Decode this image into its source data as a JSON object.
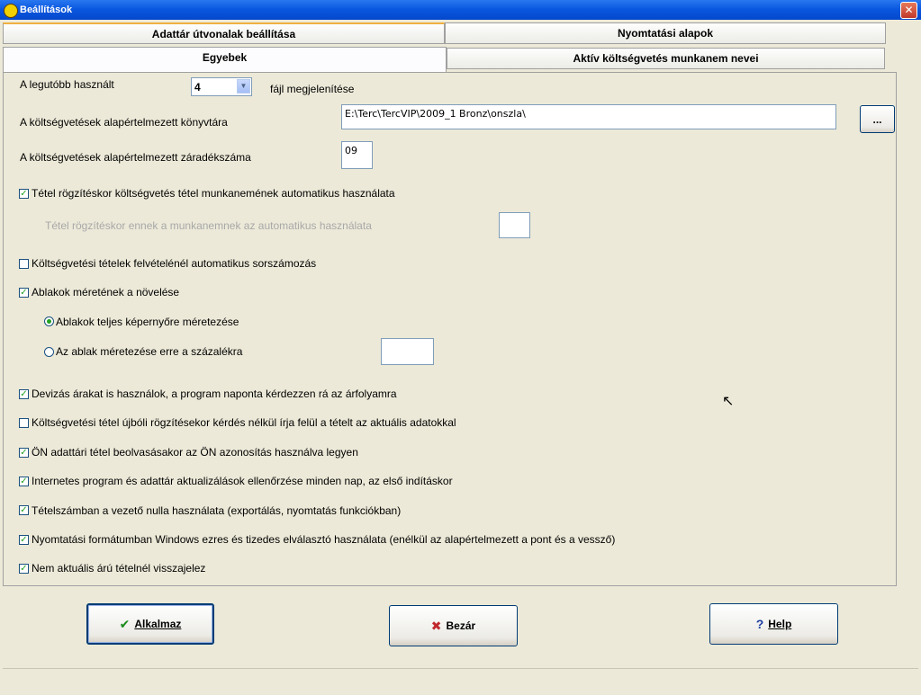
{
  "window": {
    "title": "Beállítások",
    "close_glyph": "✕"
  },
  "tabs": {
    "row1": [
      "Adattár útvonalak beállítása",
      "Nyomtatási alapok"
    ],
    "row2": [
      "Egyebek",
      "Aktív költségvetés munkanem nevei"
    ]
  },
  "recent": {
    "label": "A legutóbb használt",
    "value": "4",
    "suffix": "fájl megjelenítése"
  },
  "folder": {
    "label": "A költségvetések alapértelmezett könyvtára",
    "value": "E:\\Terc\\TercVIP\\2009_1 Bronz\\onszla\\",
    "browse_label": "..."
  },
  "clause": {
    "label": "A költségvetések alapértelmezett záradékszáma",
    "value": "09"
  },
  "options": {
    "auto_workgroup": {
      "label": "Tétel rögzítéskor költségvetés tétel munkanemének automatikus használata",
      "checked": true
    },
    "auto_workgroup_sub": {
      "label": "Tétel rögzítéskor ennek a munkanemnek az automatikus használata",
      "value": ""
    },
    "auto_numbering": {
      "label": "Költségvetési tételek felvételénél automatikus sorszámozás",
      "checked": false
    },
    "enlarge_windows": {
      "label": "Ablakok méretének a növelése",
      "checked": true
    },
    "fullscreen": {
      "label": "Ablakok teljes képernyőre méretezése",
      "selected": true
    },
    "percent": {
      "label": "Az ablak méretezése erre a százalékra",
      "selected": false,
      "value": ""
    },
    "currency": {
      "label": "Devizás árakat is használok, a program naponta kérdezzen rá az árfolyamra",
      "checked": true
    },
    "overwrite": {
      "label": "Költségvetési tétel újbóli rögzítésekor kérdés nélkül írja felül a tételt az aktuális adatokkal",
      "checked": false
    },
    "on_id": {
      "label": "ÖN adattári tétel beolvasásakor az ÖN azonosítás használva legyen",
      "checked": true
    },
    "internet_update": {
      "label": "Internetes program és adattár aktualizálások ellenőrzése minden nap, az első indításkor",
      "checked": true
    },
    "leading_zero": {
      "label": "Tételszámban a vezető nulla használata (exportálás, nyomtatás funkciókban)",
      "checked": true
    },
    "windows_separators": {
      "label": "Nyomtatási formátumban Windows ezres és tizedes elválasztó használata (enélkül az alapértelmezett a pont és a vessző)",
      "checked": true
    },
    "not_current_price": {
      "label": "Nem aktuális árú tételnél visszajelez",
      "checked": true
    }
  },
  "buttons": {
    "apply": {
      "label": "Alkalmaz",
      "icon": "check-icon",
      "color": "#1a8a1a"
    },
    "close": {
      "label": "Bezár",
      "icon": "x-icon",
      "color": "#c0282d"
    },
    "help": {
      "label": "Help",
      "icon": "question-icon",
      "color": "#1c3fa0"
    }
  }
}
